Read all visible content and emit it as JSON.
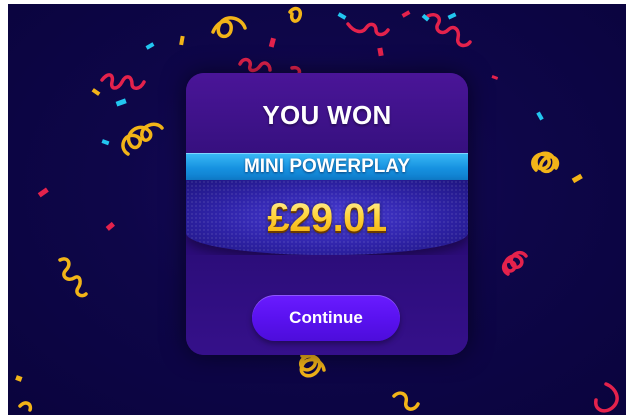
{
  "win_popup": {
    "title": "YOU WON",
    "prize_tier": "MINI POWERPLAY",
    "amount": "£29.01",
    "continue_label": "Continue"
  },
  "colors": {
    "background": "#0c0542",
    "card": "#2f0e80",
    "ribbon": "#1691e0",
    "amount_gold": "#ffd23a",
    "button": "#5a12f0",
    "confetti": [
      "#e8a21a",
      "#f7c434",
      "#e4224c",
      "#22c6f0",
      "#ff3b6b"
    ]
  }
}
